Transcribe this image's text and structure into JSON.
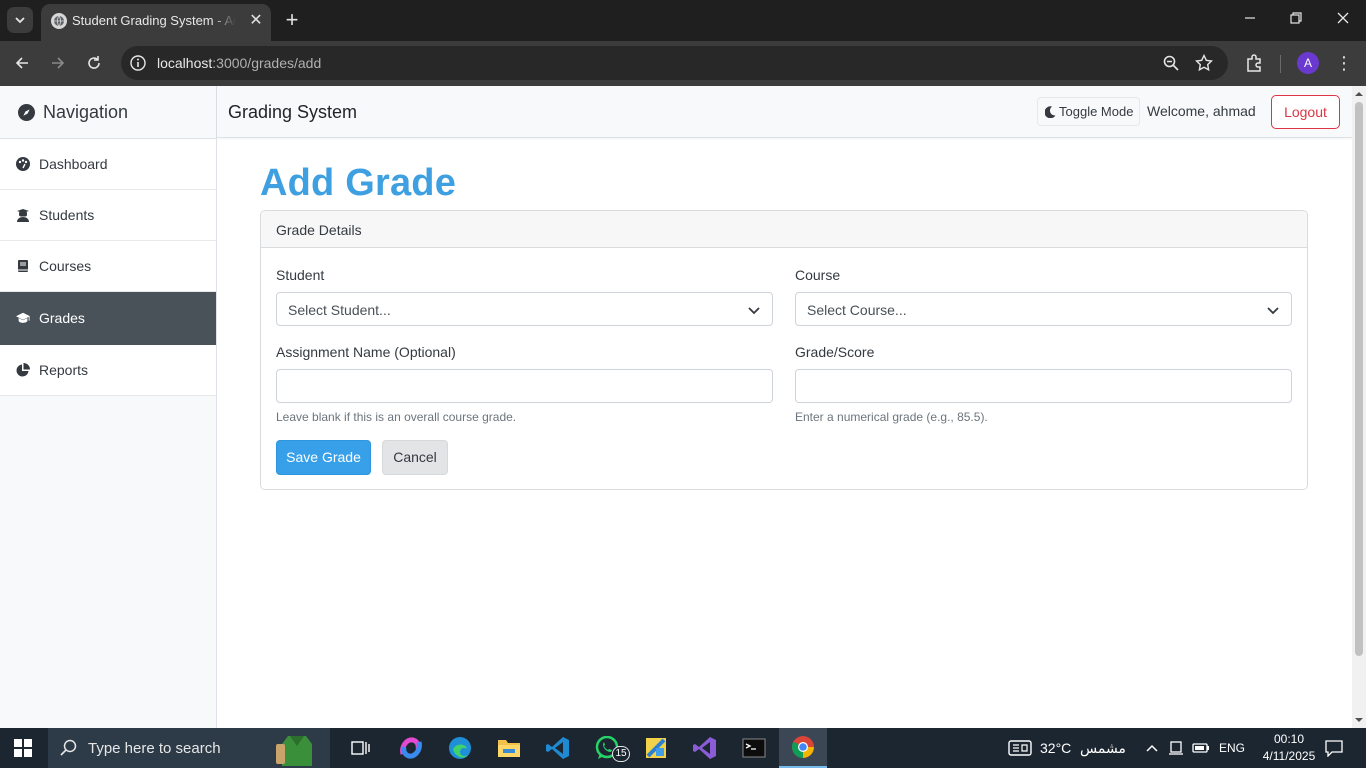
{
  "browser": {
    "tab_title": "Student Grading System - Add Grade",
    "url_host": "localhost",
    "url_rest": ":3000/grades/add",
    "profile_initial": "A"
  },
  "sidebar": {
    "title": "Navigation",
    "items": [
      {
        "label": "Dashboard",
        "icon": "palette-icon"
      },
      {
        "label": "Students",
        "icon": "user-graduate-icon"
      },
      {
        "label": "Courses",
        "icon": "book-icon"
      },
      {
        "label": "Grades",
        "icon": "graduation-cap-icon",
        "active": true
      },
      {
        "label": "Reports",
        "icon": "pie-chart-icon"
      }
    ]
  },
  "topnav": {
    "brand": "Grading System",
    "toggle_label": "Toggle Mode",
    "welcome": "Welcome, ahmad",
    "logout_label": "Logout"
  },
  "main": {
    "title": "Add Grade",
    "card_header": "Grade Details",
    "student_label": "Student",
    "student_selected": "Select Student...",
    "course_label": "Course",
    "course_selected": "Select Course...",
    "assignment_label": "Assignment Name (Optional)",
    "assignment_value": "",
    "assignment_help": "Leave blank if this is an overall course grade.",
    "grade_label": "Grade/Score",
    "grade_value": "",
    "grade_help": "Enter a numerical grade (e.g., 85.5).",
    "save_label": "Save Grade",
    "cancel_label": "Cancel"
  },
  "taskbar": {
    "search_placeholder": "Type here to search",
    "whatsapp_badge": "15",
    "weather_temp": "32°C",
    "weather_desc": "مشمس",
    "language": "ENG",
    "time": "00:10",
    "date": "4/11/2025"
  },
  "colors": {
    "accent": "#3ea0e0",
    "danger": "#dc3545",
    "sidebar_active": "#4a5259"
  }
}
